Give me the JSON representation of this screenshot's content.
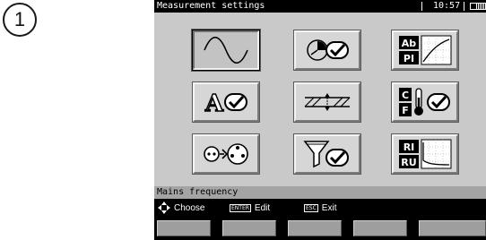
{
  "step_badge": "1",
  "device": {
    "title": "Measurement settings",
    "time": "10:57",
    "battery_level": 0.6,
    "status_text": "Mains frequency",
    "hints": {
      "choose": "Choose",
      "enter_key": "ENTER",
      "edit": "Edit",
      "esc_key": "ESC",
      "exit": "Exit"
    },
    "tiles": [
      {
        "icon": "sine-wave-icon",
        "label": "Mains frequency",
        "selected": true
      },
      {
        "icon": "clock-check-icon"
      },
      {
        "icon": "ab-pi-curve-icon",
        "text_top": "Ab",
        "text_bottom": "PI"
      },
      {
        "icon": "font-check-icon",
        "text": "A"
      },
      {
        "icon": "wire-diagram-icon"
      },
      {
        "icon": "temperature-unit-check-icon",
        "text_top": "C",
        "text_bottom": "F"
      },
      {
        "icon": "probe-connection-icon"
      },
      {
        "icon": "filter-check-icon"
      },
      {
        "icon": "ri-ru-curve-icon",
        "text_top": "RI",
        "text_bottom": "RU"
      }
    ],
    "softkey_count": 5
  }
}
